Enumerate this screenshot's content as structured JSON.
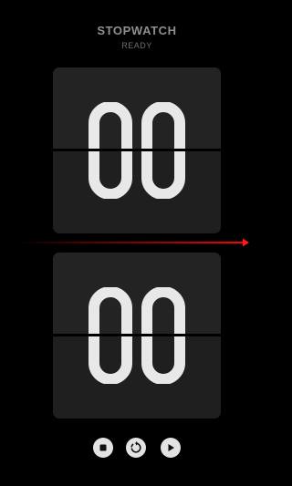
{
  "app": {
    "title": "STOPWATCH",
    "status": "READY"
  },
  "display": {
    "minutes": "00",
    "seconds": "00",
    "minutes_digits": [
      "0",
      "0"
    ],
    "seconds_digits": [
      "0",
      "0"
    ]
  },
  "controls": [
    {
      "id": "stop",
      "icon": "stop-icon"
    },
    {
      "id": "reset",
      "icon": "reset-icon"
    },
    {
      "id": "play",
      "icon": "play-icon"
    }
  ],
  "colors": {
    "background": "#000000",
    "card": "#1f1f1f",
    "digit": "#e8e8e8",
    "title": "#8f8f8f",
    "accent_arrow": "#e00000",
    "button": "#e3e3e3"
  }
}
